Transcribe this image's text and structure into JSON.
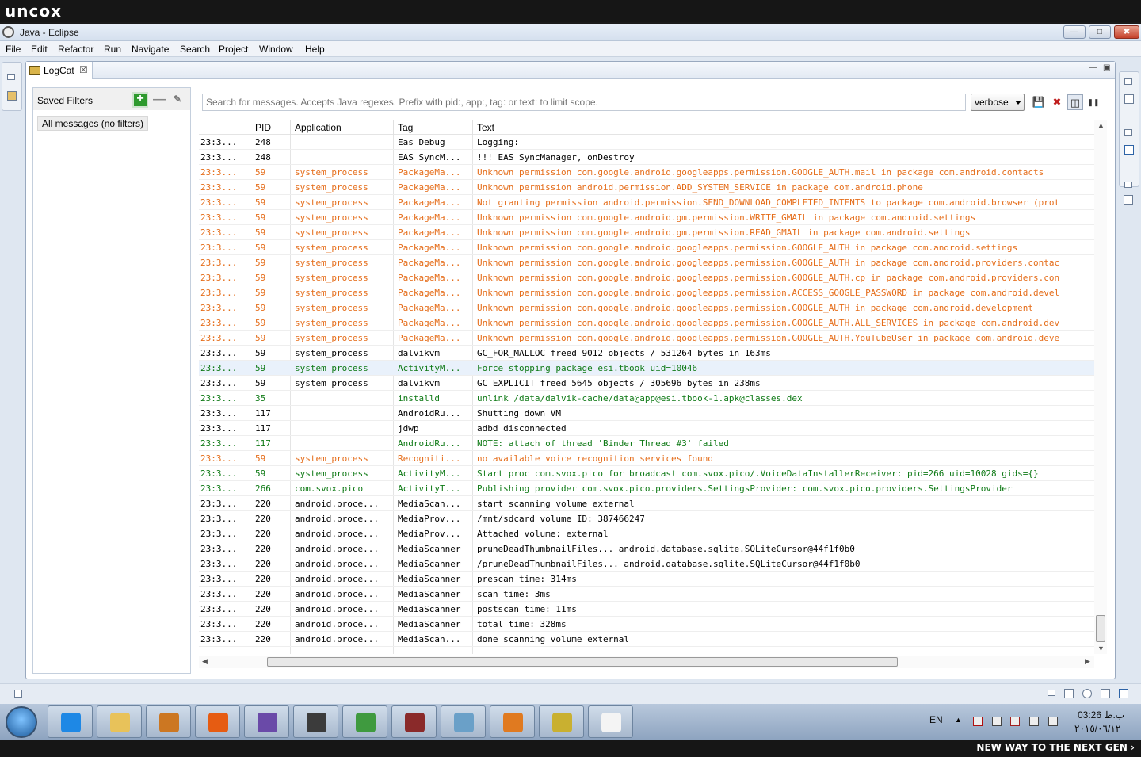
{
  "branding": {
    "top": "uncox",
    "bottom": "NEW WAY TO THE NEXT GEN ›"
  },
  "window": {
    "title": "Java - Eclipse",
    "buttons": {
      "min": "—",
      "max": "□",
      "close": "✖"
    }
  },
  "menu": [
    "File",
    "Edit",
    "Refactor",
    "Run",
    "Navigate",
    "Search",
    "Project",
    "Window",
    "Help"
  ],
  "view": {
    "tab_label": "LogCat",
    "tab_close": "☒",
    "min": "—",
    "max": "▣"
  },
  "filters": {
    "title": "Saved Filters",
    "add": "+",
    "remove": "—",
    "edit": "✎",
    "items": [
      "All messages (no filters)"
    ]
  },
  "search": {
    "placeholder": "Search for messages. Accepts Java regexes. Prefix with pid:, app:, tag: or text: to limit scope."
  },
  "log_level": "verbose",
  "toolbar": {
    "save": "💾",
    "clear": "✖",
    "toggle": "◫",
    "pause": "❚❚"
  },
  "colors": {
    "debug": "#000000",
    "warning": "#e56d1a",
    "info": "#0f7a16"
  },
  "columns": [
    "PID",
    "Application",
    "Tag",
    "Text"
  ],
  "rows": [
    {
      "time": "23:3...",
      "pid": "248",
      "app": "",
      "tag": "Eas Debug",
      "text": "Logging:",
      "level": "debug"
    },
    {
      "time": "23:3...",
      "pid": "248",
      "app": "",
      "tag": "EAS SyncM...",
      "text": "!!! EAS SyncManager, onDestroy",
      "level": "debug"
    },
    {
      "time": "23:3...",
      "pid": "59",
      "app": "system_process",
      "tag": "PackageMa...",
      "text": "Unknown permission com.google.android.googleapps.permission.GOOGLE_AUTH.mail in package com.android.contacts",
      "level": "warning"
    },
    {
      "time": "23:3...",
      "pid": "59",
      "app": "system_process",
      "tag": "PackageMa...",
      "text": "Unknown permission android.permission.ADD_SYSTEM_SERVICE in package com.android.phone",
      "level": "warning"
    },
    {
      "time": "23:3...",
      "pid": "59",
      "app": "system_process",
      "tag": "PackageMa...",
      "text": "Not granting permission android.permission.SEND_DOWNLOAD_COMPLETED_INTENTS to package com.android.browser (prot",
      "level": "warning"
    },
    {
      "time": "23:3...",
      "pid": "59",
      "app": "system_process",
      "tag": "PackageMa...",
      "text": "Unknown permission com.google.android.gm.permission.WRITE_GMAIL in package com.android.settings",
      "level": "warning"
    },
    {
      "time": "23:3...",
      "pid": "59",
      "app": "system_process",
      "tag": "PackageMa...",
      "text": "Unknown permission com.google.android.gm.permission.READ_GMAIL in package com.android.settings",
      "level": "warning"
    },
    {
      "time": "23:3...",
      "pid": "59",
      "app": "system_process",
      "tag": "PackageMa...",
      "text": "Unknown permission com.google.android.googleapps.permission.GOOGLE_AUTH in package com.android.settings",
      "level": "warning"
    },
    {
      "time": "23:3...",
      "pid": "59",
      "app": "system_process",
      "tag": "PackageMa...",
      "text": "Unknown permission com.google.android.googleapps.permission.GOOGLE_AUTH in package com.android.providers.contac",
      "level": "warning"
    },
    {
      "time": "23:3...",
      "pid": "59",
      "app": "system_process",
      "tag": "PackageMa...",
      "text": "Unknown permission com.google.android.googleapps.permission.GOOGLE_AUTH.cp in package com.android.providers.con",
      "level": "warning"
    },
    {
      "time": "23:3...",
      "pid": "59",
      "app": "system_process",
      "tag": "PackageMa...",
      "text": "Unknown permission com.google.android.googleapps.permission.ACCESS_GOOGLE_PASSWORD in package com.android.devel",
      "level": "warning"
    },
    {
      "time": "23:3...",
      "pid": "59",
      "app": "system_process",
      "tag": "PackageMa...",
      "text": "Unknown permission com.google.android.googleapps.permission.GOOGLE_AUTH in package com.android.development",
      "level": "warning"
    },
    {
      "time": "23:3...",
      "pid": "59",
      "app": "system_process",
      "tag": "PackageMa...",
      "text": "Unknown permission com.google.android.googleapps.permission.GOOGLE_AUTH.ALL_SERVICES in package com.android.dev",
      "level": "warning"
    },
    {
      "time": "23:3...",
      "pid": "59",
      "app": "system_process",
      "tag": "PackageMa...",
      "text": "Unknown permission com.google.android.googleapps.permission.GOOGLE_AUTH.YouTubeUser in package com.android.deve",
      "level": "warning"
    },
    {
      "time": "23:3...",
      "pid": "59",
      "app": "system_process",
      "tag": "dalvikvm",
      "text": "GC_FOR_MALLOC freed 9012 objects / 531264 bytes in 163ms",
      "level": "debug"
    },
    {
      "time": "23:3...",
      "pid": "59",
      "app": "system_process",
      "tag": "ActivityM...",
      "text": "Force stopping package esi.tbook uid=10046",
      "level": "info",
      "highlight": true
    },
    {
      "time": "23:3...",
      "pid": "59",
      "app": "system_process",
      "tag": "dalvikvm",
      "text": "GC_EXPLICIT freed 5645 objects / 305696 bytes in 238ms",
      "level": "debug"
    },
    {
      "time": "23:3...",
      "pid": "35",
      "app": "",
      "tag": "installd",
      "text": "unlink /data/dalvik-cache/data@app@esi.tbook-1.apk@classes.dex",
      "level": "info"
    },
    {
      "time": "23:3...",
      "pid": "117",
      "app": "",
      "tag": "AndroidRu...",
      "text": "Shutting down VM",
      "level": "debug"
    },
    {
      "time": "23:3...",
      "pid": "117",
      "app": "",
      "tag": "jdwp",
      "text": "adbd disconnected",
      "level": "debug"
    },
    {
      "time": "23:3...",
      "pid": "117",
      "app": "",
      "tag": "AndroidRu...",
      "text": "NOTE: attach of thread 'Binder Thread #3' failed",
      "level": "info"
    },
    {
      "time": "23:3...",
      "pid": "59",
      "app": "system_process",
      "tag": "Recogniti...",
      "text": "no available voice recognition services found",
      "level": "warning"
    },
    {
      "time": "23:3...",
      "pid": "59",
      "app": "system_process",
      "tag": "ActivityM...",
      "text": "Start proc com.svox.pico for broadcast com.svox.pico/.VoiceDataInstallerReceiver: pid=266 uid=10028 gids={}",
      "level": "info"
    },
    {
      "time": "23:3...",
      "pid": "266",
      "app": "com.svox.pico",
      "tag": "ActivityT...",
      "text": "Publishing provider com.svox.pico.providers.SettingsProvider: com.svox.pico.providers.SettingsProvider",
      "level": "info"
    },
    {
      "time": "23:3...",
      "pid": "220",
      "app": "android.proce...",
      "tag": "MediaScan...",
      "text": "start scanning volume external",
      "level": "debug"
    },
    {
      "time": "23:3...",
      "pid": "220",
      "app": "android.proce...",
      "tag": "MediaProv...",
      "text": "/mnt/sdcard volume ID: 387466247",
      "level": "debug"
    },
    {
      "time": "23:3...",
      "pid": "220",
      "app": "android.proce...",
      "tag": "MediaProv...",
      "text": "Attached volume: external",
      "level": "debug"
    },
    {
      "time": "23:3...",
      "pid": "220",
      "app": "android.proce...",
      "tag": "MediaScanner",
      "text": "pruneDeadThumbnailFiles... android.database.sqlite.SQLiteCursor@44f1f0b0",
      "level": "debug"
    },
    {
      "time": "23:3...",
      "pid": "220",
      "app": "android.proce...",
      "tag": "MediaScanner",
      "text": "/pruneDeadThumbnailFiles... android.database.sqlite.SQLiteCursor@44f1f0b0",
      "level": "debug"
    },
    {
      "time": "23:3...",
      "pid": "220",
      "app": "android.proce...",
      "tag": "MediaScanner",
      "text": " prescan time: 314ms",
      "level": "debug"
    },
    {
      "time": "23:3...",
      "pid": "220",
      "app": "android.proce...",
      "tag": "MediaScanner",
      "text": "    scan time: 3ms",
      "level": "debug"
    },
    {
      "time": "23:3...",
      "pid": "220",
      "app": "android.proce...",
      "tag": "MediaScanner",
      "text": "postscan time: 11ms",
      "level": "debug"
    },
    {
      "time": "23:3...",
      "pid": "220",
      "app": "android.proce...",
      "tag": "MediaScanner",
      "text": "   total time: 328ms",
      "level": "debug"
    },
    {
      "time": "23:3...",
      "pid": "220",
      "app": "android.proce...",
      "tag": "MediaScan...",
      "text": "done scanning volume external",
      "level": "debug"
    }
  ],
  "taskbar": {
    "apps": [
      "internet-explorer-icon",
      "file-explorer-icon",
      "media-player-icon",
      "firefox-icon",
      "visual-studio-icon",
      "java-ee-ide-icon",
      "download-manager-icon",
      "winrar-icon",
      "notepad-icon",
      "sublime-icon",
      "paint-icon",
      "eclipse-task-icon"
    ],
    "lang": "EN",
    "clock_time": "03:26 ب.ظ",
    "clock_date": "٢٠١٥/٠٦/١٢"
  }
}
